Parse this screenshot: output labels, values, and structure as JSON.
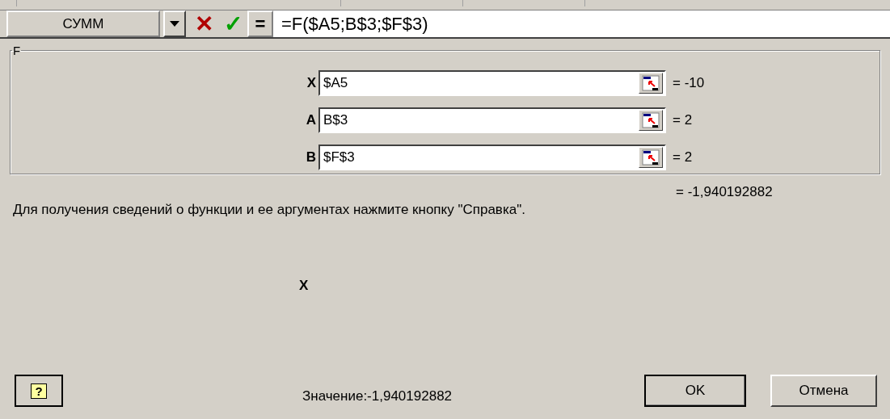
{
  "formula_bar": {
    "name_box": "СУММ",
    "cancel": "✕",
    "enter": "✓",
    "equals": "=",
    "formula": "=F($A5;B$3;$F$3)"
  },
  "dialog": {
    "group_title": "F",
    "arguments": [
      {
        "label": "X",
        "value": "$A5",
        "result": "= -10"
      },
      {
        "label": "A",
        "value": "B$3",
        "result": "= 2"
      },
      {
        "label": "B",
        "value": "$F$3",
        "result": "= 2"
      }
    ],
    "function_result": "= -1,940192882",
    "description": "Для получения сведений о функции и ее аргументах нажмите кнопку \"Справка\".",
    "argument_name": "X",
    "help_button": "?",
    "value_text": "Значение:-1,940192882",
    "buttons": [
      {
        "label": "OK",
        "default": true
      },
      {
        "label": "Отмена",
        "default": false
      }
    ]
  }
}
